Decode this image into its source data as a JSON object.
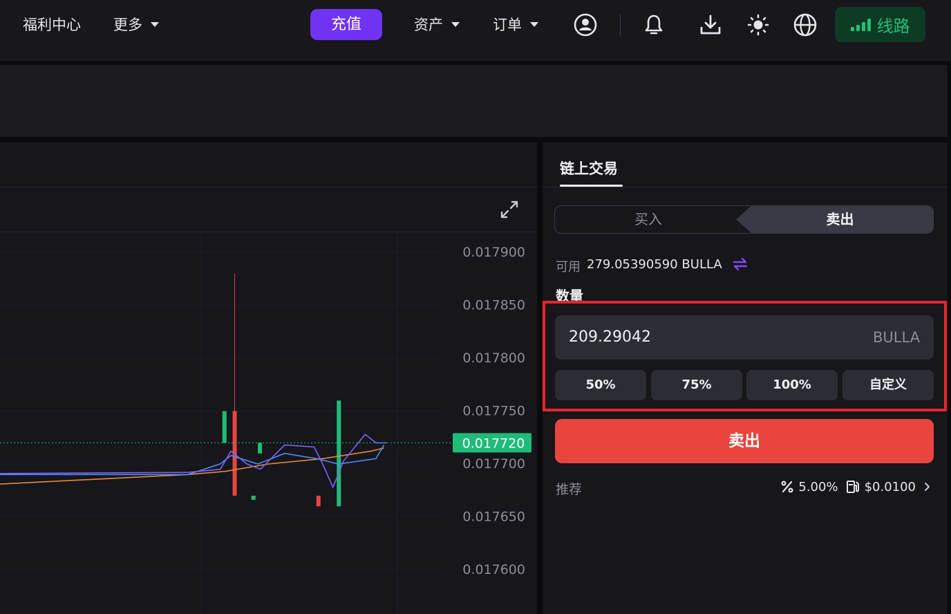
{
  "header": {
    "welfare_label": "福利中心",
    "more_label": "更多",
    "deposit_label": "充值",
    "assets_label": "资产",
    "orders_label": "订单",
    "route_label": "线路",
    "icons": [
      "user-icon",
      "bell-icon",
      "download-icon",
      "sun-icon",
      "globe-icon",
      "signal-icon"
    ]
  },
  "chart": {
    "price_labels": [
      "0.017900",
      "0.017850",
      "0.017800",
      "0.017750",
      "0.017700",
      "0.017650",
      "0.017600"
    ],
    "current_price": "0.017720"
  },
  "chart_data": {
    "type": "candlestick",
    "y_ticks": [
      0.0179,
      0.01785,
      0.0178,
      0.01775,
      0.0177,
      0.01765,
      0.0176
    ],
    "current_price": 0.01772,
    "candles": [
      {
        "x": 0.418,
        "open": 0.01772,
        "close": 0.01775,
        "high": 0.01775,
        "low": 0.01772,
        "dir": "up"
      },
      {
        "x": 0.437,
        "open": 0.01775,
        "close": 0.01767,
        "high": 0.01788,
        "low": 0.01767,
        "dir": "down"
      },
      {
        "x": 0.472,
        "open": 0.01767,
        "close": 0.01767,
        "high": 0.01767,
        "low": 0.01767,
        "dir": "up"
      },
      {
        "x": 0.484,
        "open": 0.01771,
        "close": 0.01772,
        "high": 0.01772,
        "low": 0.01771,
        "dir": "up"
      },
      {
        "x": 0.593,
        "open": 0.01767,
        "close": 0.01766,
        "high": 0.01767,
        "low": 0.01766,
        "dir": "down"
      },
      {
        "x": 0.631,
        "open": 0.01766,
        "close": 0.01776,
        "high": 0.01776,
        "low": 0.01766,
        "dir": "up"
      }
    ],
    "colors": {
      "up": "#1ebc78",
      "down": "#e9453f",
      "ma_fast": "#7b63ff",
      "ma_mid": "#4f8df2",
      "ma_slow": "#e88a3a"
    }
  },
  "trade": {
    "panel_title": "链上交易",
    "buy_label": "买入",
    "sell_tab_label": "卖出",
    "available_label": "可用",
    "available_value": "279.05390590 BULLA",
    "quantity_label": "数量",
    "quantity_value": "209.29042",
    "quantity_unit": "BULLA",
    "pct_options": [
      "50%",
      "75%",
      "100%",
      "自定义"
    ],
    "sell_button_label": "卖出",
    "recommend_label": "推荐",
    "slippage_value": "5.00%",
    "gas_value": "$0.0100"
  },
  "colors": {
    "accent_purple": "#7033f4",
    "sell_red": "#e9453f",
    "buy_green": "#1ebc78",
    "highlight_red": "#e4262c"
  }
}
